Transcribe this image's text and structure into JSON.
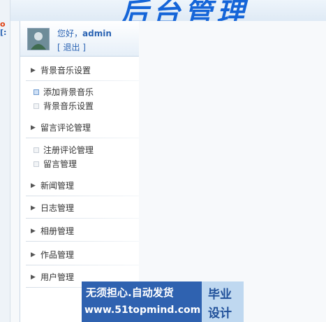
{
  "header": {
    "title": "后台管理"
  },
  "edge": {
    "mark_top": "o",
    "mark_bottom": "[:"
  },
  "user": {
    "greeting": "您好，",
    "username": "admin",
    "logout": "[ 退出 ]"
  },
  "menu": {
    "bgmusic": {
      "title": "背景音乐设置",
      "items": [
        "添加背景音乐",
        "背景音乐设置"
      ]
    },
    "comment": {
      "title": "留言评论管理",
      "items": [
        "注册评论管理",
        "留言管理"
      ]
    },
    "news": {
      "title": "新闻管理"
    },
    "log": {
      "title": "日志管理"
    },
    "album": {
      "title": "相册管理"
    },
    "works": {
      "title": "作品管理"
    },
    "users": {
      "title": "用户管理"
    }
  },
  "watermark": {
    "line1": "无须担心.自动发货",
    "line2": "www.51topmind.com",
    "right_top": "毕业",
    "right_bottom": "设计"
  },
  "colors": {
    "accent": "#2a63b3",
    "title": "#1565d8",
    "watermark_bg": "#2f62b0"
  }
}
